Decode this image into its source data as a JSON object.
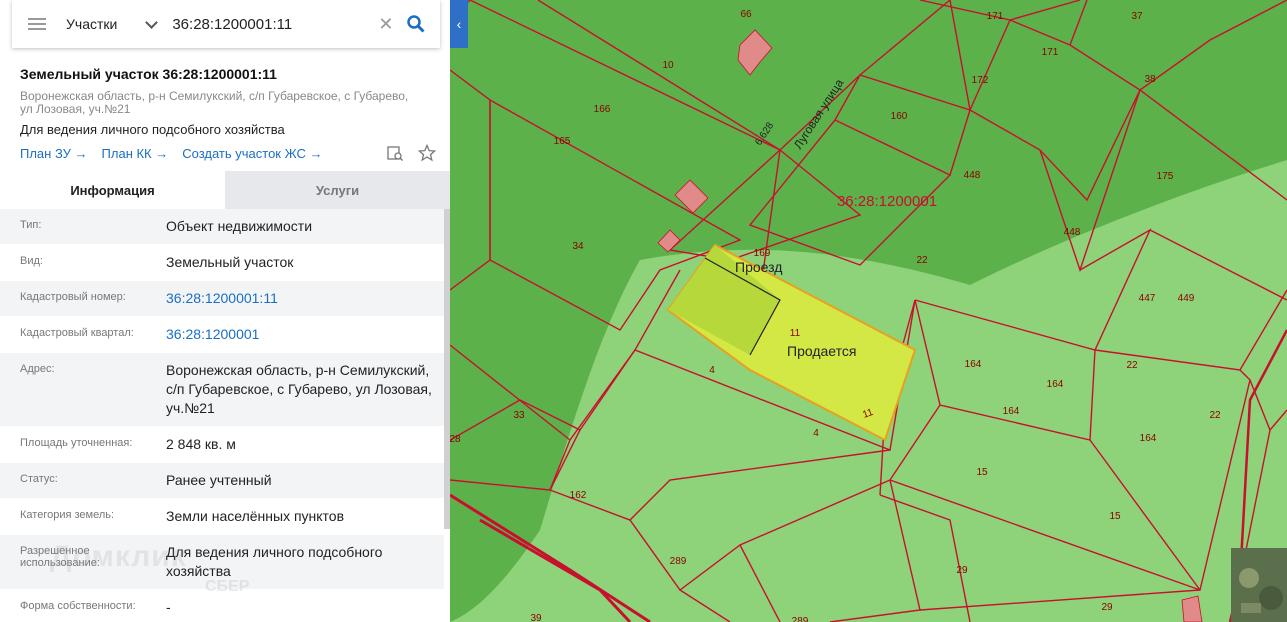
{
  "search": {
    "type_label": "Участки",
    "query": "36:28:1200001:11"
  },
  "parcel": {
    "title": "Земельный участок 36:28:1200001:11",
    "address": "Воронежская область, р-н Семилукский, с/п Губаревское, с Губарево, ул Лозовая, уч.№21",
    "purpose": "Для ведения личного подсобного хозяйства",
    "links": [
      "План ЗУ →",
      "План КК →",
      "Создать участок ЖС →"
    ]
  },
  "tabs": [
    "Информация",
    "Услуги"
  ],
  "info_rows": [
    {
      "label": "Тип:",
      "value": "Объект недвижимости"
    },
    {
      "label": "Вид:",
      "value": "Земельный участок"
    },
    {
      "label": "Кадастровый номер:",
      "value": "36:28:1200001:11"
    },
    {
      "label": "Кадастровый квартал:",
      "value": "36:28:1200001"
    },
    {
      "label": "Адрес:",
      "value": "Воронежская область, р-н Семилукский, с/п Губаревское, с Губарево, ул Лозовая, уч.№21"
    },
    {
      "label": "Площадь уточненная:",
      "value": "2 848 кв. м"
    },
    {
      "label": "Статус:",
      "value": "Ранее учтенный"
    },
    {
      "label": "Категория земель:",
      "value": "Земли населённых пунктов"
    },
    {
      "label": "Разрешенное использование:",
      "value": "Для ведения личного подсобного хозяйства"
    },
    {
      "label": "Форма собственности:",
      "value": "-"
    }
  ],
  "watermark": {
    "brand": "Домклик",
    "sub": "СБЕР"
  },
  "map": {
    "quarter_label": "36:28:1200001",
    "street_label": "Луговая улица",
    "street_number": "6.628",
    "selected_label": "Продается",
    "driveway_label": "Проезд",
    "parcel_numbers": [
      "66",
      "171",
      "37",
      "10",
      "167",
      "171",
      "172",
      "38",
      "166",
      "160",
      "165",
      "175",
      "448",
      "167",
      "36:28:1200001",
      "34",
      "169",
      "22",
      "448",
      "447",
      "449",
      "11",
      "4",
      "164",
      "164",
      "22",
      "33",
      "164",
      "22",
      "28",
      "4",
      "164",
      "15",
      "162",
      "15",
      "289",
      "29",
      "39",
      "289",
      "29",
      "297",
      "11"
    ],
    "colors": {
      "dark_green": "#5cb14b",
      "light_green": "#8ed27a",
      "border": "#c8102e",
      "selected": "#d4e845",
      "building": "#e08a8a"
    }
  }
}
